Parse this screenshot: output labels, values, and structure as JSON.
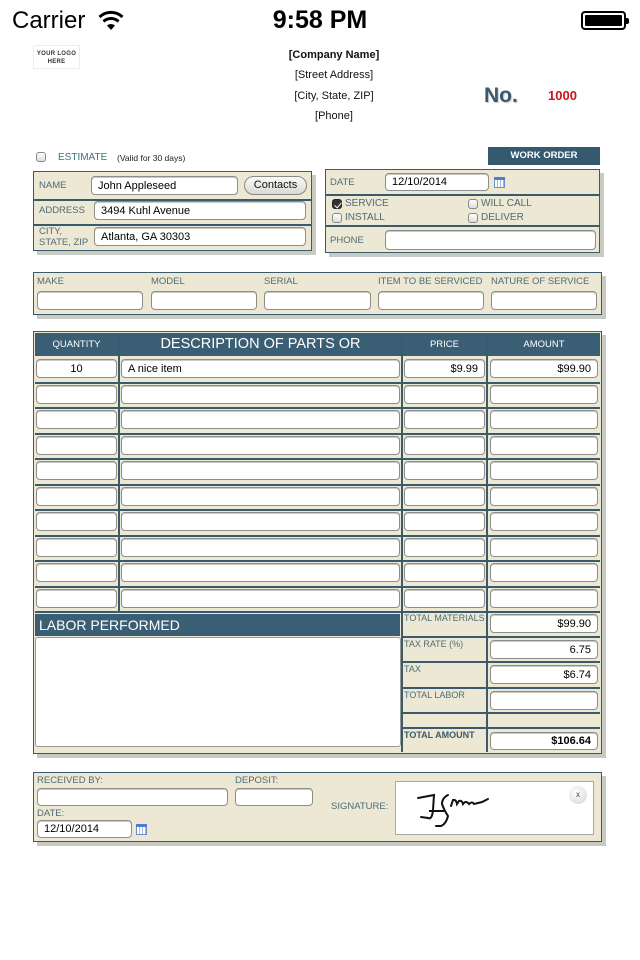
{
  "status_bar": {
    "carrier": "Carrier",
    "time": "9:58 PM",
    "battery_level": 1.0
  },
  "header": {
    "logo_line1": "YOUR LOGO",
    "logo_line2": "HERE",
    "company_name": "[Company Name]",
    "street": "[Street Address]",
    "city": "[City, State, ZIP]",
    "phone": "[Phone]",
    "number_label": "No.",
    "number_value": "1000"
  },
  "estimate": {
    "label": "ESTIMATE",
    "note": "(Valid for 30 days)",
    "checked": false
  },
  "work_order_badge": "WORK ORDER",
  "customer": {
    "name_label": "NAME",
    "name_value": "John Appleseed",
    "contacts_button": "Contacts",
    "address_label": "ADDRESS",
    "address_value": "3494 Kuhl Avenue",
    "city_label_1": "CITY,",
    "city_label_2": "STATE, ZIP",
    "city_value": "Atlanta, GA 30303"
  },
  "order": {
    "date_label": "DATE",
    "date_value": "12/10/2014",
    "options": [
      {
        "label": "SERVICE",
        "checked": true
      },
      {
        "label": "WILL CALL",
        "checked": false
      },
      {
        "label": "INSTALL",
        "checked": false
      },
      {
        "label": "DELIVER",
        "checked": false
      }
    ],
    "phone_label": "PHONE",
    "phone_value": ""
  },
  "item": {
    "columns": [
      "MAKE",
      "MODEL",
      "SERIAL",
      "ITEM TO BE SERVICED",
      "NATURE OF SERVICE"
    ],
    "values": [
      "",
      "",
      "",
      "",
      ""
    ]
  },
  "parts": {
    "headers": [
      "QUANTITY",
      "DESCRIPTION OF PARTS OR MATERIALS",
      "PRICE",
      "AMOUNT"
    ],
    "rows": [
      [
        "10",
        "A nice item",
        "$9.99",
        "$99.90"
      ],
      [
        "",
        "",
        "",
        ""
      ],
      [
        "",
        "",
        "",
        ""
      ],
      [
        "",
        "",
        "",
        ""
      ],
      [
        "",
        "",
        "",
        ""
      ],
      [
        "",
        "",
        "",
        ""
      ],
      [
        "",
        "",
        "",
        ""
      ],
      [
        "",
        "",
        "",
        ""
      ],
      [
        "",
        "",
        "",
        ""
      ],
      [
        "",
        "",
        "",
        ""
      ]
    ]
  },
  "labor": {
    "header": "LABOR PERFORMED",
    "text": ""
  },
  "totals": {
    "total_materials_label": "TOTAL MATERIALS",
    "total_materials": "$99.90",
    "tax_rate_label": "TAX RATE (%)",
    "tax_rate": "6.75",
    "tax_label": "TAX",
    "tax": "$6.74",
    "total_labor_label": "TOTAL LABOR",
    "total_labor": "",
    "total_amount_label": "TOTAL AMOUNT",
    "total_amount": "$106.64"
  },
  "footer": {
    "received_by_label": "RECEIVED BY:",
    "received_by_value": "",
    "deposit_label": "DEPOSIT:",
    "deposit_value": "",
    "date_label": "DATE:",
    "date_value": "12/10/2014",
    "signature_label": "SIGNATURE:",
    "clear_button": "x"
  }
}
